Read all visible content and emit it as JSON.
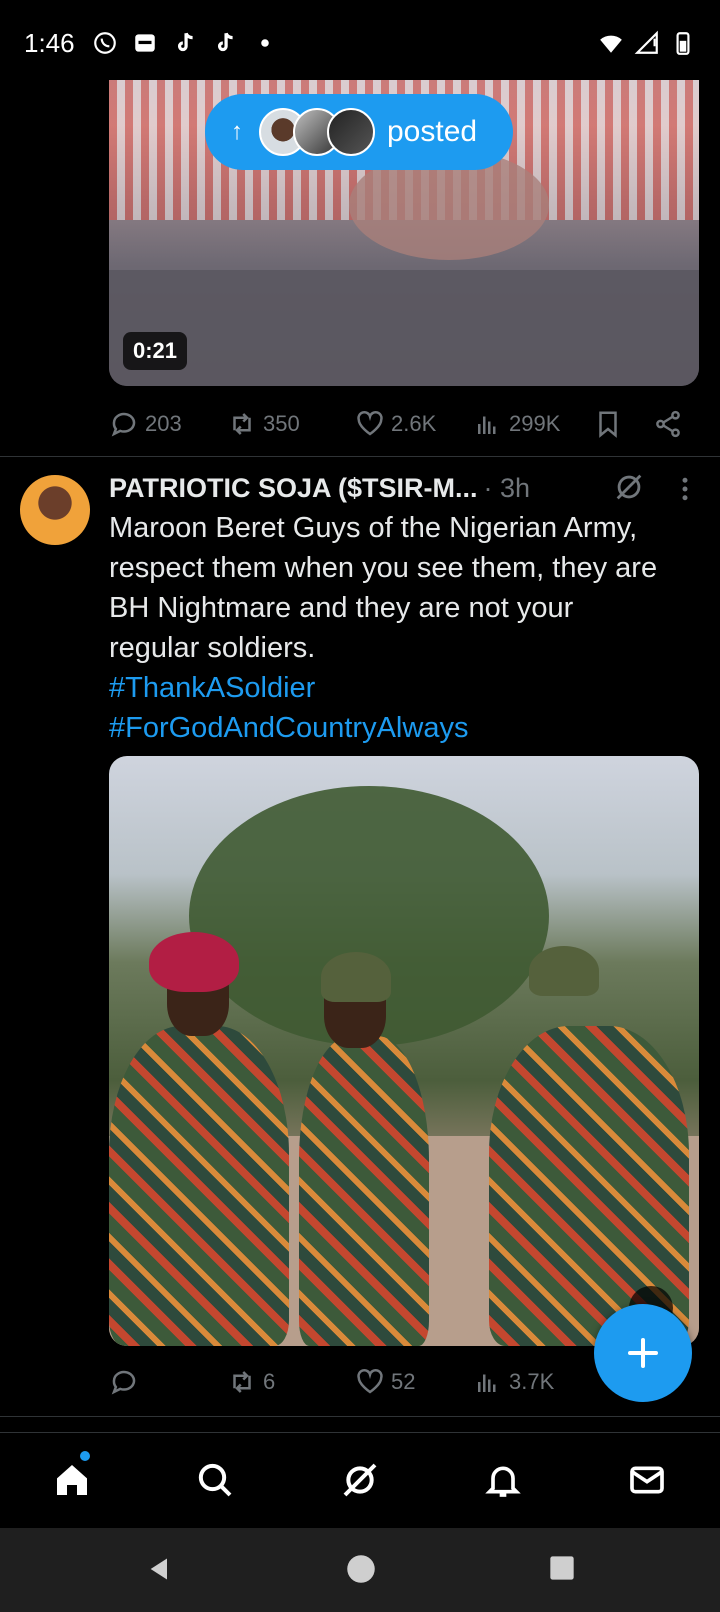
{
  "status_bar": {
    "time": "1:46",
    "left_icons": [
      "whatsapp-icon",
      "gallery-icon",
      "tiktok-icon",
      "tiktok-icon",
      "dot-icon"
    ],
    "right_icons": [
      "wifi-icon",
      "signal-icon",
      "battery-icon"
    ]
  },
  "tweet1": {
    "video_duration": "0:21",
    "posted_pill": {
      "label": "posted"
    },
    "actions": {
      "replies": "203",
      "reposts": "350",
      "likes": "2.6K",
      "views": "299K"
    }
  },
  "tweet2": {
    "author": "PATRIOTIC SOJA ($TSIR-M...",
    "time": "· 3h",
    "text_lines": [
      "Maroon Beret Guys of the Nigerian Army,",
      "respect them when you see them, they are",
      "BH Nightmare and they are not your",
      "regular soldiers."
    ],
    "hashtags": [
      "#ThankASoldier",
      "#ForGodAndCountryAlways"
    ],
    "actions": {
      "replies": "",
      "reposts": "6",
      "likes": "52",
      "views": "3.7K"
    }
  },
  "bottom_nav": [
    "home-icon",
    "search-icon",
    "grok-icon",
    "notifications-icon",
    "messages-icon"
  ],
  "colors": {
    "accent": "#1d9bf0",
    "background": "#000000",
    "muted": "#71767b",
    "divider": "#2f3336"
  }
}
